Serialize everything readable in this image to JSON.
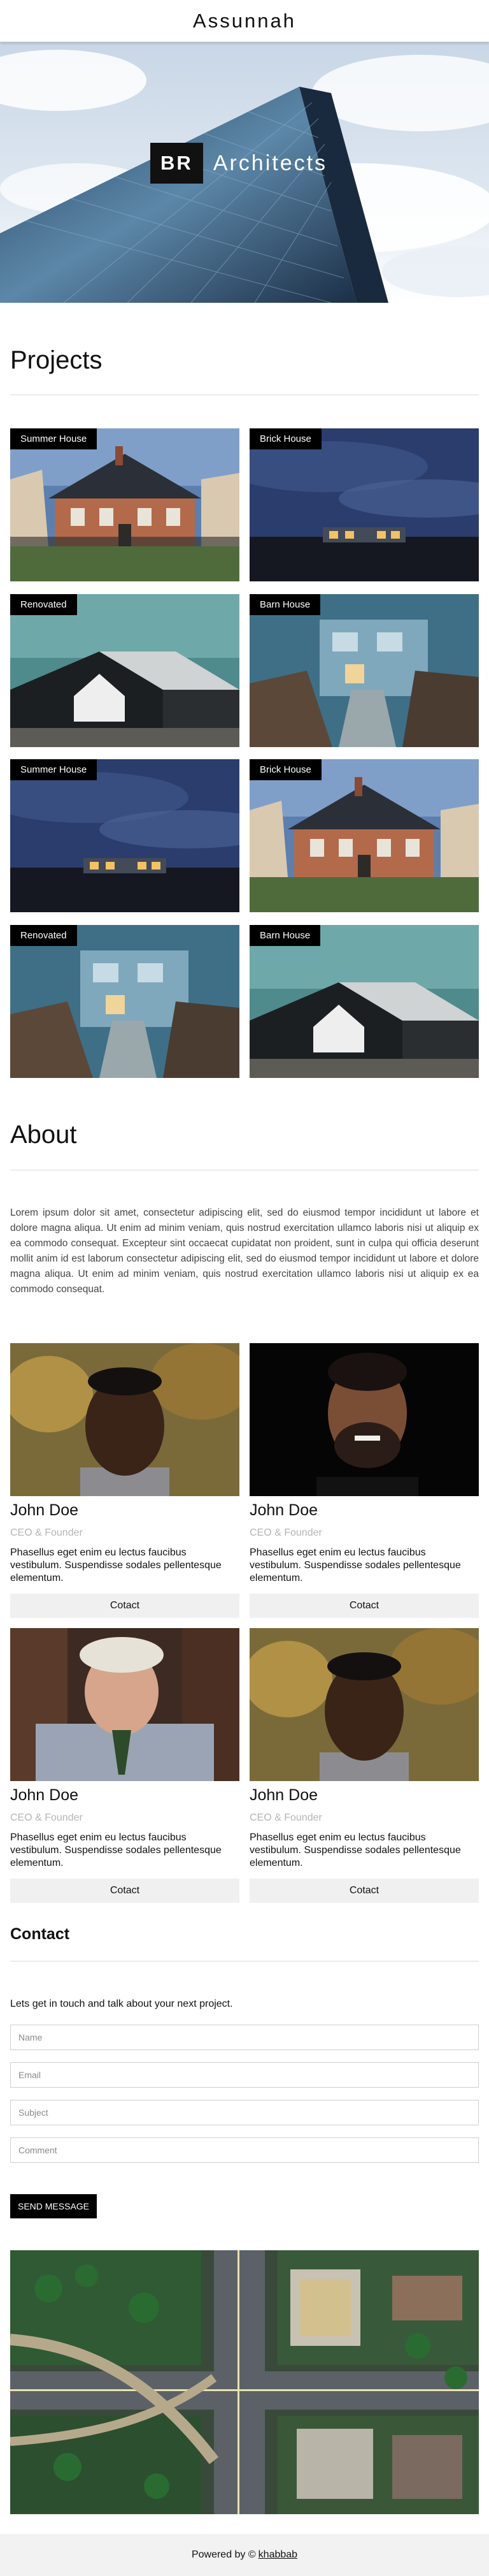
{
  "nav": {
    "brand": "Assunnah"
  },
  "hero": {
    "logo_box": "BR",
    "logo_word": "Architects"
  },
  "projects": {
    "title": "Projects",
    "items": [
      {
        "tag": "Summer House"
      },
      {
        "tag": "Brick House"
      },
      {
        "tag": "Renovated"
      },
      {
        "tag": "Barn House"
      },
      {
        "tag": "Summer House"
      },
      {
        "tag": "Brick House"
      },
      {
        "tag": "Renovated"
      },
      {
        "tag": "Barn House"
      }
    ]
  },
  "about": {
    "title": "About",
    "text": "Lorem ipsum dolor sit amet, consectetur adipiscing elit, sed do eiusmod tempor incididunt ut labore et dolore magna aliqua. Ut enim ad minim veniam, quis nostrud exercitation ullamco laboris nisi ut aliquip ex ea commodo consequat. Excepteur sint occaecat cupidatat non proident, sunt in culpa qui officia deserunt mollit anim id est laborum consectetur adipiscing elit, sed do eiusmod tempor incididunt ut labore et dolore magna aliqua. Ut enim ad minim veniam, quis nostrud exercitation ullamco laboris nisi ut aliquip ex ea commodo consequat."
  },
  "team": [
    {
      "name": "John Doe",
      "role": "CEO & Founder",
      "bio": "Phasellus eget enim eu lectus faucibus vestibulum. Suspendisse sodales pellentesque elementum.",
      "button": "Cotact"
    },
    {
      "name": "John Doe",
      "role": "CEO & Founder",
      "bio": "Phasellus eget enim eu lectus faucibus vestibulum. Suspendisse sodales pellentesque elementum.",
      "button": "Cotact"
    },
    {
      "name": "John Doe",
      "role": "CEO & Founder",
      "bio": "Phasellus eget enim eu lectus faucibus vestibulum. Suspendisse sodales pellentesque elementum.",
      "button": "Cotact"
    },
    {
      "name": "John Doe",
      "role": "CEO & Founder",
      "bio": "Phasellus eget enim eu lectus faucibus vestibulum. Suspendisse sodales pellentesque elementum.",
      "button": "Cotact"
    }
  ],
  "contact": {
    "title": "Contact",
    "intro": "Lets get in touch and talk about your next project.",
    "fields": {
      "name_placeholder": "Name",
      "email_placeholder": "Email",
      "subject_placeholder": "Subject",
      "comment_placeholder": "Comment"
    },
    "submit_label": "SEND MESSAGE"
  },
  "footer": {
    "prefix": "Powered by ©",
    "link": "khabbab"
  }
}
